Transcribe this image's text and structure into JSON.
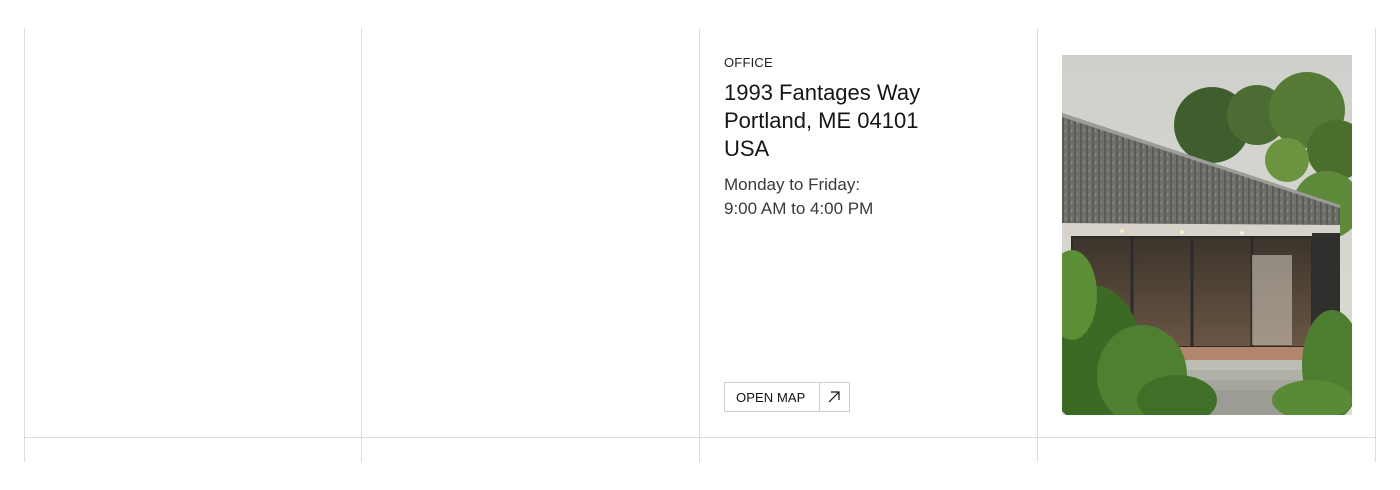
{
  "office": {
    "eyebrow": "OFFICE",
    "address_lines": [
      "1993 Fantages Way",
      "Portland, ME 04101",
      "USA"
    ],
    "hours_lines": [
      "Monday to Friday:",
      "9:00 AM to 4:00 PM"
    ],
    "map_button": {
      "label": "OPEN MAP",
      "icon": "arrow-up-right-icon"
    }
  },
  "photo": {
    "subject": "modern-house-photo"
  }
}
